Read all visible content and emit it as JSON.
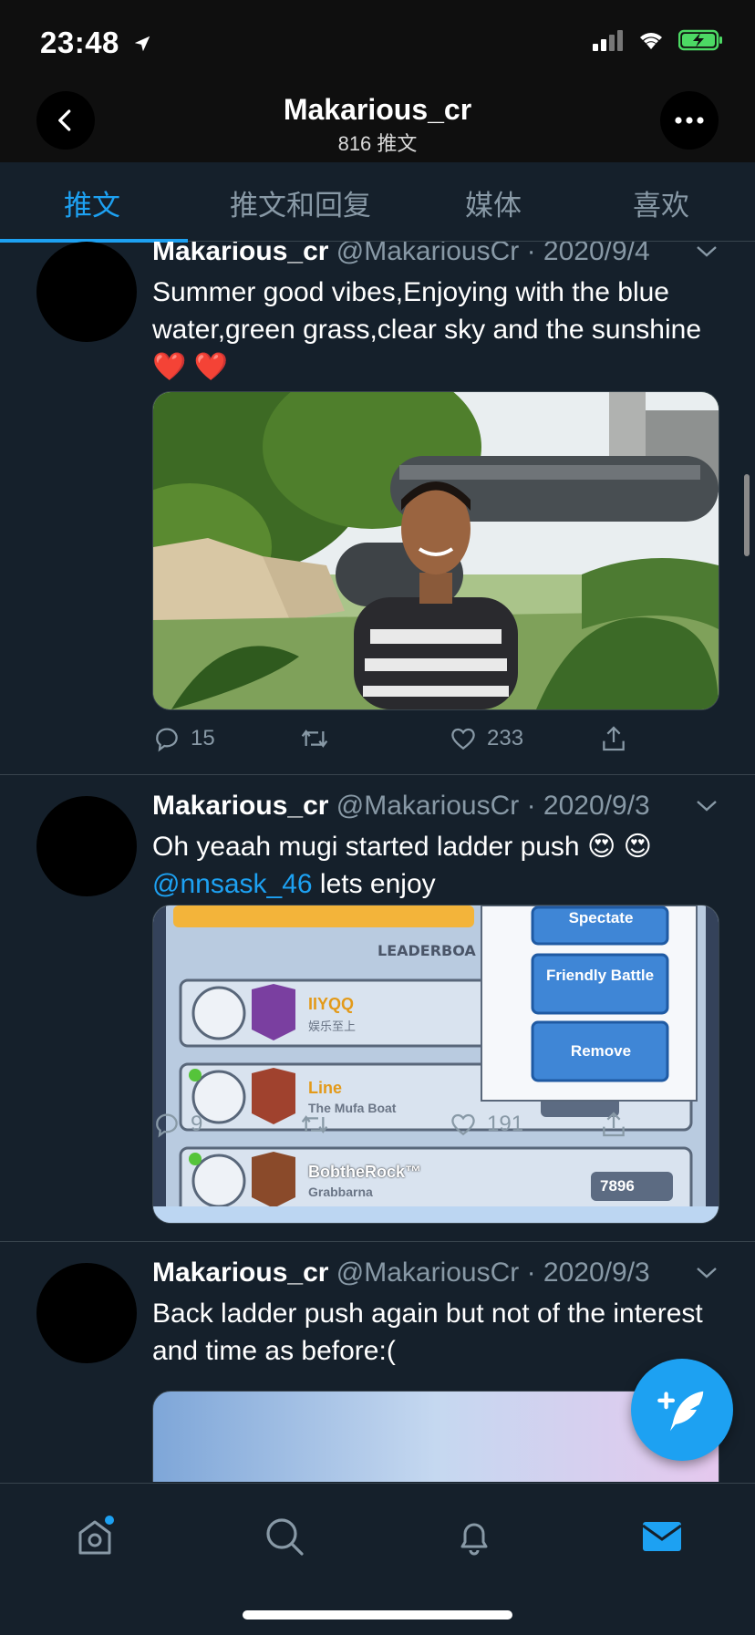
{
  "status": {
    "time": "23:48"
  },
  "header": {
    "title": "Makarious_cr",
    "subtitle": "816 推文"
  },
  "tabs": [
    {
      "label": "推文",
      "active": true
    },
    {
      "label": "推文和回复",
      "active": false
    },
    {
      "label": "媒体",
      "active": false
    },
    {
      "label": "喜欢",
      "active": false
    }
  ],
  "tweets": [
    {
      "name": "Makarious_cr",
      "meta": "@MakariousCr · 2020/9/4",
      "text": "Summer good vibes,Enjoying with the blue water,green grass,clear sky and the sunshine❤️ ❤️",
      "replies": "15",
      "likes": "233"
    },
    {
      "name": "Makarious_cr",
      "meta": "@MakariousCr · 2020/9/3",
      "text_a": "Oh yeaah mugi started ladder push 😍 😍",
      "mention": "@nnsask_46",
      "text_b": " lets enjoy",
      "replies": "9",
      "likes": "191",
      "game": {
        "leaderboard_label": "LEADERBOA",
        "menu": [
          "Spectate",
          "Friendly Battle",
          "Remove"
        ],
        "players": [
          {
            "name": "IIYQQ",
            "clan": "娱乐至上"
          },
          {
            "name": "Line",
            "clan": "The Mufa Boat"
          },
          {
            "name": "BobtheRock™",
            "clan": "Grabbarna",
            "trophies": "7896"
          }
        ]
      }
    },
    {
      "name": "Makarious_cr",
      "meta": "@MakariousCr · 2020/9/3",
      "text": "Back ladder push again but not of the interest and time as before:("
    }
  ],
  "colors": {
    "accent": "#1da1f2",
    "background": "#15202b",
    "muted": "#8899a6"
  },
  "icons": [
    "back-arrow-icon",
    "more-icon",
    "reply-icon",
    "retweet-icon",
    "like-icon",
    "share-icon",
    "compose-icon",
    "home-icon",
    "search-icon",
    "bell-icon",
    "mail-icon"
  ]
}
